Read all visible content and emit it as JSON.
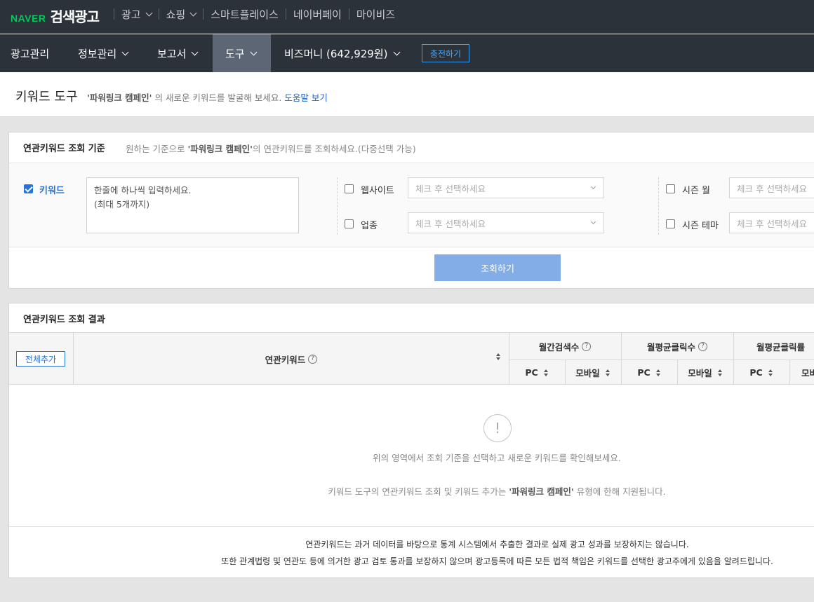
{
  "topbar": {
    "logo_naver": "NAVER",
    "logo_brand": "검색광고",
    "nav": [
      {
        "label": "광고",
        "has_dropdown": true
      },
      {
        "label": "쇼핑",
        "has_dropdown": true
      },
      {
        "label": "스마트플레이스",
        "has_dropdown": false
      },
      {
        "label": "네이버페이",
        "has_dropdown": false
      },
      {
        "label": "마이비즈",
        "has_dropdown": false
      }
    ]
  },
  "mainnav": {
    "items": [
      {
        "label": "광고관리",
        "has_dropdown": false
      },
      {
        "label": "정보관리",
        "has_dropdown": true
      },
      {
        "label": "보고서",
        "has_dropdown": true
      },
      {
        "label": "도구",
        "has_dropdown": true,
        "active": true
      },
      {
        "label": "비즈머니 (642,929원)",
        "has_dropdown": true
      }
    ],
    "charge_button": "충전하기"
  },
  "page": {
    "title": "키워드 도구",
    "desc_campaign": "'파워링크 캠페인'",
    "desc_text": " 의 새로운 키워드를 발굴해 보세요. ",
    "help_link": "도움말 보기"
  },
  "criteria": {
    "title": "연관키워드 조회 기준",
    "sub_prefix": "원하는 기준으로 ",
    "sub_campaign": "'파워링크 캠페인'",
    "sub_suffix": "의 연관키워드를 조회하세요.(다중선택 가능)",
    "keyword": {
      "label": "키워드",
      "checked": true,
      "placeholder": "한줄에 하나씩 입력하세요.\n(최대 5개까지)"
    },
    "website": {
      "label": "웹사이트",
      "checked": false,
      "select_placeholder": "체크 후 선택하세요"
    },
    "industry": {
      "label": "업종",
      "checked": false,
      "select_placeholder": "체크 후 선택하세요"
    },
    "season_month": {
      "label": "시즌 월",
      "checked": false,
      "select_placeholder": "체크 후 선택하세요"
    },
    "season_theme": {
      "label": "시즌 테마",
      "checked": false,
      "select_placeholder": "체크 후 선택하세요"
    },
    "search_button": "조회하기"
  },
  "results": {
    "title": "연관키워드 조회 결과",
    "add_all_button": "전체추가",
    "columns": {
      "keyword": "연관키워드",
      "monthly_search": "월간검색수",
      "monthly_clicks": "월평균클릭수",
      "monthly_ctr": "월평균클릭률",
      "pc": "PC",
      "mobile": "모바일",
      "mobile_cut": "모바"
    },
    "empty_icon": "exclamation-icon",
    "empty_message": "위의 영역에서 조회 기준을 선택하고 새로운 키워드를 확인해보세요.",
    "support_prefix": "키워드 도구의 연관키워드 조회 및 키워드 추가는 ",
    "support_campaign": "'파워링크 캠페인'",
    "support_suffix": " 유형에 한해 지원됩니다.",
    "notice_line1": "연관키워드는 과거 데이터를 바탕으로 통계 시스템에서 추출한 결과로 실제 광고 성과를 보장하지는 않습니다.",
    "notice_line2": "또한 관계법령 및 연관도 등에 의거한 광고 검토 통과를 보장하지 않으며 광고등록에 따른 모든 법적 책임은 키워드를 선택한 광고주에게 있음을 알려드립니다."
  }
}
